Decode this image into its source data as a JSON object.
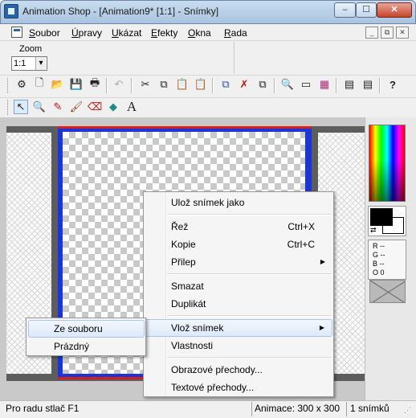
{
  "window": {
    "title": "Animation Shop - [Animation9* [1:1] - Snímky]",
    "minimize_glyph": "–",
    "maximize_glyph": "☐",
    "close_glyph": "✕"
  },
  "menubar": {
    "items": [
      {
        "label": "Soubor",
        "accel": "S",
        "rest": "oubor"
      },
      {
        "label": "Úpravy",
        "accel": "Ú",
        "rest": "pravy"
      },
      {
        "label": "Ukázat",
        "accel": "U",
        "rest": "kázat"
      },
      {
        "label": "Efekty",
        "accel": "E",
        "rest": "fekty"
      },
      {
        "label": "Okna",
        "accel": "O",
        "rest": "kna"
      },
      {
        "label": "Rada",
        "accel": "R",
        "rest": "ada"
      }
    ],
    "mdi_buttons": [
      "_",
      "⧉",
      "✕"
    ]
  },
  "zoom": {
    "label": "Zoom",
    "value": "1:1"
  },
  "toolbar1": {
    "icons": [
      "wizard-icon",
      "new-icon",
      "open-icon",
      "save-icon",
      "print-icon",
      "undo-icon",
      "cut-icon",
      "copy-icon",
      "paste-icon",
      "paste-special-icon",
      "insert-frame-icon",
      "delete-frame-icon",
      "frame-properties-icon",
      "preview-icon",
      "view-frames-icon",
      "palette-icon",
      "frame-strip-icon",
      "frame-strip-2-icon",
      "help-icon"
    ],
    "glyphs": [
      "⚙",
      "🗋",
      "📂",
      "💾",
      "🖶",
      "↶",
      "✂",
      "⧉",
      "📋",
      "📋",
      "⧉",
      "✗",
      "⧉",
      "🔍",
      "▭",
      "▦",
      "▤",
      "▤",
      "?"
    ]
  },
  "toolbar2": {
    "icons": [
      "arrow-icon",
      "magnifier-icon",
      "dropper-icon",
      "brush-icon",
      "eraser-icon",
      "fill-icon",
      "text-icon"
    ],
    "glyphs": [
      "↖",
      "🔍",
      "✎",
      "🖌",
      "⌫",
      "◆",
      "A"
    ]
  },
  "colors": {
    "rgbo": [
      "R --",
      "G --",
      "B --",
      "O 0"
    ],
    "foreground": "#000000",
    "background": "#ffffff",
    "frame_border": "#1b35d6",
    "frame_edge": "#d62020"
  },
  "context_menu": {
    "items": [
      {
        "label": "Ulož snímek jako",
        "shortcut": ""
      },
      {
        "label": "Řež",
        "shortcut": "Ctrl+X"
      },
      {
        "label": "Kopie",
        "shortcut": "Ctrl+C"
      },
      {
        "label": "Přilep",
        "shortcut": "",
        "submenu": "▶"
      },
      {
        "label": "Smazat",
        "shortcut": ""
      },
      {
        "label": "Duplikát",
        "shortcut": ""
      },
      {
        "label": "Vlož snímek",
        "shortcut": "",
        "submenu": "▶"
      },
      {
        "label": "Vlastnosti",
        "shortcut": ""
      },
      {
        "label": "Obrazové přechody...",
        "shortcut": ""
      },
      {
        "label": "Textové přechody...",
        "shortcut": ""
      }
    ]
  },
  "submenu": {
    "items": [
      "Ze souboru",
      "Prázdný"
    ]
  },
  "statusbar": {
    "hint": "Pro radu stlač F1",
    "animation": "Animace: 300 x 300",
    "frames": "1 snímků"
  }
}
